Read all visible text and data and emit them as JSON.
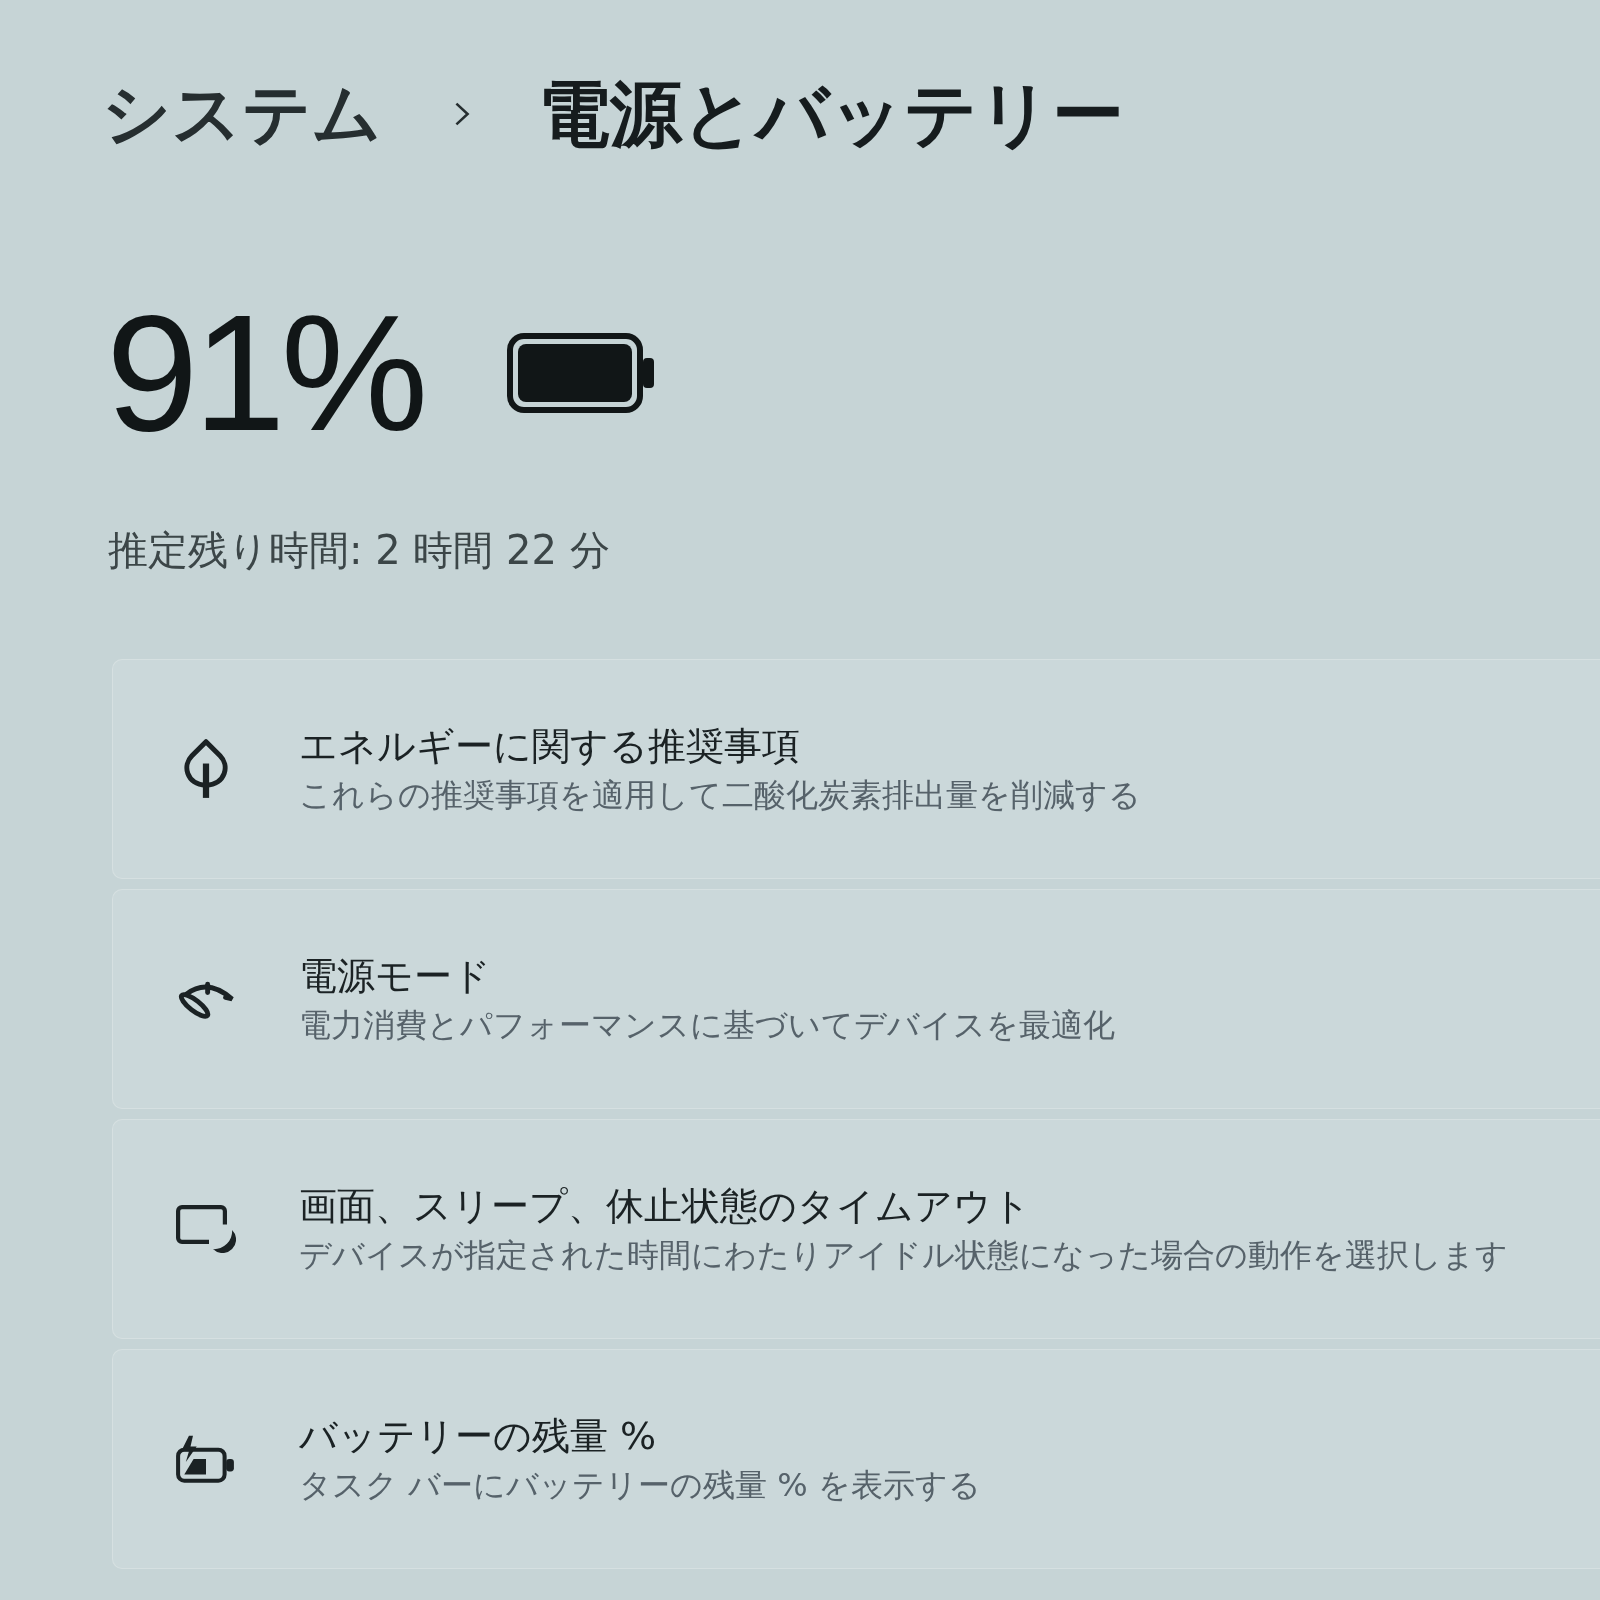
{
  "breadcrumb": {
    "parent": "システム",
    "current": "電源とバッテリー"
  },
  "battery": {
    "percentage": "91%",
    "estimate": "推定残り時間: 2 時間 22 分"
  },
  "settings": [
    {
      "kind": "recommendations",
      "title": "エネルギーに関する推奨事項",
      "description": "これらの推奨事項を適用して二酸化炭素排出量を削減する"
    },
    {
      "kind": "mode",
      "title": "電源モード",
      "description": "電力消費とパフォーマンスに基づいてデバイスを最適化"
    },
    {
      "kind": "timeout",
      "title": "画面、スリープ、休止状態のタイムアウト",
      "description": "デバイスが指定された時間にわたりアイドル状態になった場合の動作を選択します"
    },
    {
      "kind": "percentage",
      "title": "バッテリーの残量 %",
      "description": "タスク バーにバッテリーの残量 % を表示する"
    }
  ]
}
